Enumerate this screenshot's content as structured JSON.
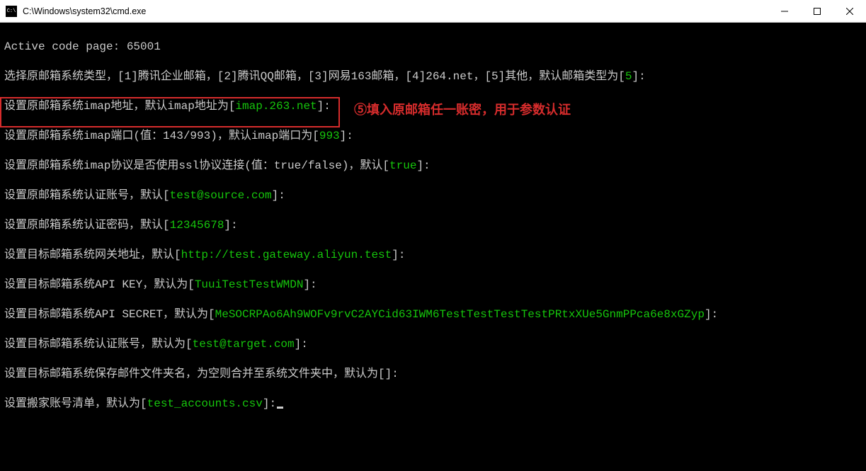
{
  "titlebar": {
    "icon_label": "C:\\",
    "title": "C:\\Windows\\system32\\cmd.exe"
  },
  "terminal": {
    "line0": "Active code page: 65001",
    "line1": {
      "a": "选择原邮箱系统类型，[1]腾讯企业邮箱，[2]腾讯QQ邮箱，[3]网易163邮箱，[4]264.net，[5]其他，默认邮箱类型为[",
      "b": "5",
      "c": "]:"
    },
    "line2": {
      "a": "设置原邮箱系统imap地址，默认imap地址为[",
      "b": "imap.263.net",
      "c": "]:"
    },
    "line3": {
      "a": "设置原邮箱系统imap端口(值：143/993)，默认imap端口为[",
      "b": "993",
      "c": "]:"
    },
    "line4": {
      "a": "设置原邮箱系统imap协议是否使用ssl协议连接(值：true/false)，默认[",
      "b": "true",
      "c": "]:"
    },
    "line5": {
      "a": "设置原邮箱系统认证账号，默认[",
      "b": "test@source.com",
      "c": "]:"
    },
    "line6": {
      "a": "设置原邮箱系统认证密码，默认[",
      "b": "12345678",
      "c": "]:"
    },
    "line7": {
      "a": "设置目标邮箱系统网关地址，默认[",
      "b": "http://test.gateway.aliyun.test",
      "c": "]:"
    },
    "line8": {
      "a": "设置目标邮箱系统API KEY，默认为[",
      "b": "TuuiTestTestWMDN",
      "c": "]:"
    },
    "line9": {
      "a": "设置目标邮箱系统API SECRET，默认为[",
      "b": "MeSOCRPAo6Ah9WOFv9rvC2AYCid63IWM6TestTestTestTestPRtxXUe5GnmPPca6e8xGZyp",
      "c": "]:"
    },
    "line10": {
      "a": "设置目标邮箱系统认证账号，默认为[",
      "b": "test@target.com",
      "c": "]:"
    },
    "line11": {
      "a": "设置目标邮箱系统保存邮件文件夹名，为空则合并至系统文件夹中，默认为[]:"
    },
    "line12": {
      "a": "设置搬家账号清单，默认为[",
      "b": "test_accounts.csv",
      "c": "]:"
    }
  },
  "annotation": {
    "text": "⑤填入原邮箱任一账密，用于参数认证"
  }
}
